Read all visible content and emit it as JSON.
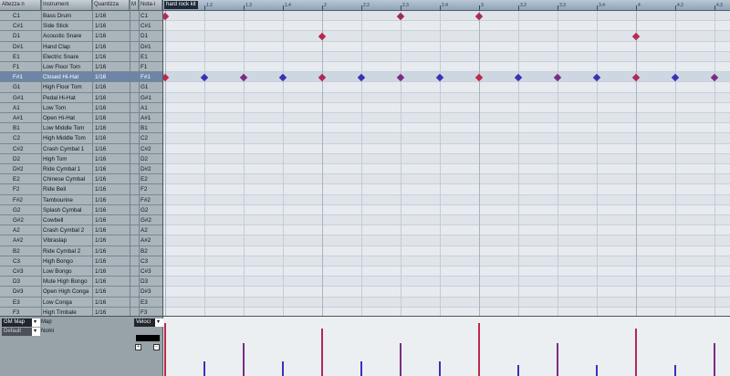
{
  "list_header": {
    "pitch": "Altezza n",
    "instrument": "Instrument",
    "quantize": "Quantizza",
    "mute": "M",
    "note": "Nota-i"
  },
  "drums": [
    {
      "pitch": "C1",
      "name": "Bass Drum",
      "quant": "1/16",
      "note": "C1"
    },
    {
      "pitch": "C#1",
      "name": "Side Stick",
      "quant": "1/16",
      "note": "C#1"
    },
    {
      "pitch": "D1",
      "name": "Acoustic Snare",
      "quant": "1/16",
      "note": "D1"
    },
    {
      "pitch": "D#1",
      "name": "Hand Clap",
      "quant": "1/16",
      "note": "D#1"
    },
    {
      "pitch": "E1",
      "name": "Electric Snare",
      "quant": "1/16",
      "note": "E1"
    },
    {
      "pitch": "F1",
      "name": "Low Floor Tom",
      "quant": "1/16",
      "note": "F1"
    },
    {
      "pitch": "F#1",
      "name": "Closed Hi-Hat",
      "quant": "1/16",
      "note": "F#1"
    },
    {
      "pitch": "G1",
      "name": "High Floor Tom",
      "quant": "1/16",
      "note": "G1"
    },
    {
      "pitch": "G#1",
      "name": "Pedal Hi-Hat",
      "quant": "1/16",
      "note": "G#1"
    },
    {
      "pitch": "A1",
      "name": "Low Tom",
      "quant": "1/16",
      "note": "A1"
    },
    {
      "pitch": "A#1",
      "name": "Open Hi-Hat",
      "quant": "1/16",
      "note": "A#1"
    },
    {
      "pitch": "B1",
      "name": "Low Middle Tom",
      "quant": "1/16",
      "note": "B1"
    },
    {
      "pitch": "C2",
      "name": "High Middle Tom",
      "quant": "1/16",
      "note": "C2"
    },
    {
      "pitch": "C#2",
      "name": "Crash Cymbal 1",
      "quant": "1/16",
      "note": "C#2"
    },
    {
      "pitch": "D2",
      "name": "High Tom",
      "quant": "1/16",
      "note": "D2"
    },
    {
      "pitch": "D#2",
      "name": "Ride Cymbal 1",
      "quant": "1/16",
      "note": "D#2"
    },
    {
      "pitch": "E2",
      "name": "Chinese Cymbal",
      "quant": "1/16",
      "note": "E2"
    },
    {
      "pitch": "F2",
      "name": "Ride Bell",
      "quant": "1/16",
      "note": "F2"
    },
    {
      "pitch": "F#2",
      "name": "Tambourine",
      "quant": "1/16",
      "note": "F#2"
    },
    {
      "pitch": "G2",
      "name": "Splash Cymbal",
      "quant": "1/16",
      "note": "G2"
    },
    {
      "pitch": "G#2",
      "name": "Cowbell",
      "quant": "1/16",
      "note": "G#2"
    },
    {
      "pitch": "A2",
      "name": "Crash Cymbal 2",
      "quant": "1/16",
      "note": "A2"
    },
    {
      "pitch": "A#2",
      "name": "Vibraslap",
      "quant": "1/16",
      "note": "A#2"
    },
    {
      "pitch": "B2",
      "name": "Ride Cymbal 2",
      "quant": "1/16",
      "note": "B2"
    },
    {
      "pitch": "C3",
      "name": "High Bongo",
      "quant": "1/16",
      "note": "C3"
    },
    {
      "pitch": "C#3",
      "name": "Low Bongo",
      "quant": "1/16",
      "note": "C#3"
    },
    {
      "pitch": "D3",
      "name": "Mute High Bongo",
      "quant": "1/16",
      "note": "D3"
    },
    {
      "pitch": "D#3",
      "name": "Open High Conga",
      "quant": "1/16",
      "note": "D#3"
    },
    {
      "pitch": "E3",
      "name": "Low Conga",
      "quant": "1/16",
      "note": "E3"
    },
    {
      "pitch": "F3",
      "name": "High Timbale",
      "quant": "1/16",
      "note": "F3"
    }
  ],
  "selected_pitch": "F#1",
  "ruler": {
    "kit_label": "hard rock kit",
    "ticks": [
      "1.2",
      "1.3",
      "1.4",
      "2",
      "2.2",
      "2.3",
      "2.4",
      "3",
      "3.2",
      "3.3",
      "3.4",
      "4",
      "4.2",
      "4.3"
    ]
  },
  "notes": [
    {
      "row": "C1",
      "pos": 0,
      "color": "#b02a5a"
    },
    {
      "row": "C1",
      "pos": 6,
      "color": "#a0285e"
    },
    {
      "row": "C1",
      "pos": 8,
      "color": "#a82a60"
    },
    {
      "row": "D1",
      "pos": 4,
      "color": "#b8284e"
    },
    {
      "row": "D1",
      "pos": 12,
      "color": "#b82a52"
    },
    {
      "row": "F#1",
      "pos": 0,
      "color": "#c0284a"
    },
    {
      "row": "F#1",
      "pos": 1,
      "color": "#3a30b8"
    },
    {
      "row": "F#1",
      "pos": 2,
      "color": "#7a2c84"
    },
    {
      "row": "F#1",
      "pos": 3,
      "color": "#3a30b8"
    },
    {
      "row": "F#1",
      "pos": 4,
      "color": "#b0285a"
    },
    {
      "row": "F#1",
      "pos": 5,
      "color": "#3a30b8"
    },
    {
      "row": "F#1",
      "pos": 6,
      "color": "#7a2c84"
    },
    {
      "row": "F#1",
      "pos": 7,
      "color": "#3a30b8"
    },
    {
      "row": "F#1",
      "pos": 8,
      "color": "#c0284a"
    },
    {
      "row": "F#1",
      "pos": 9,
      "color": "#3a30b8"
    },
    {
      "row": "F#1",
      "pos": 10,
      "color": "#7a2c84"
    },
    {
      "row": "F#1",
      "pos": 11,
      "color": "#3a30b8"
    },
    {
      "row": "F#1",
      "pos": 12,
      "color": "#b0285a"
    },
    {
      "row": "F#1",
      "pos": 13,
      "color": "#3a30b8"
    },
    {
      "row": "F#1",
      "pos": 14,
      "color": "#7a2c84"
    }
  ],
  "velocity_bars": [
    {
      "pos": 0,
      "level": 1.0,
      "color": "#c0284a"
    },
    {
      "pos": 1,
      "level": 0.28,
      "color": "#3a30b8"
    },
    {
      "pos": 2,
      "level": 0.62,
      "color": "#7a2c84"
    },
    {
      "pos": 3,
      "level": 0.28,
      "color": "#3a30b8"
    },
    {
      "pos": 4,
      "level": 0.9,
      "color": "#b0285a"
    },
    {
      "pos": 5,
      "level": 0.28,
      "color": "#3a30b8"
    },
    {
      "pos": 6,
      "level": 0.62,
      "color": "#7a2c84"
    },
    {
      "pos": 7,
      "level": 0.28,
      "color": "#3a30b8"
    },
    {
      "pos": 8,
      "level": 1.0,
      "color": "#c0284a"
    },
    {
      "pos": 9,
      "level": 0.2,
      "color": "#3a30b8"
    },
    {
      "pos": 10,
      "level": 0.62,
      "color": "#7a2c84"
    },
    {
      "pos": 11,
      "level": 0.2,
      "color": "#3a30b8"
    },
    {
      "pos": 12,
      "level": 0.9,
      "color": "#b0285a"
    },
    {
      "pos": 13,
      "level": 0.2,
      "color": "#3a30b8"
    },
    {
      "pos": 14,
      "level": 0.62,
      "color": "#7a2c84"
    }
  ],
  "bottom": {
    "map_select": "GM Map",
    "map_label": "Map",
    "names_select": "Default",
    "names_label": "Nomi",
    "controller_select": "Veloci"
  },
  "colors": {
    "note_high": "#c0284a",
    "note_mid": "#7a2c84",
    "note_low": "#3a30b8",
    "selected_row": "#6d86a8"
  }
}
